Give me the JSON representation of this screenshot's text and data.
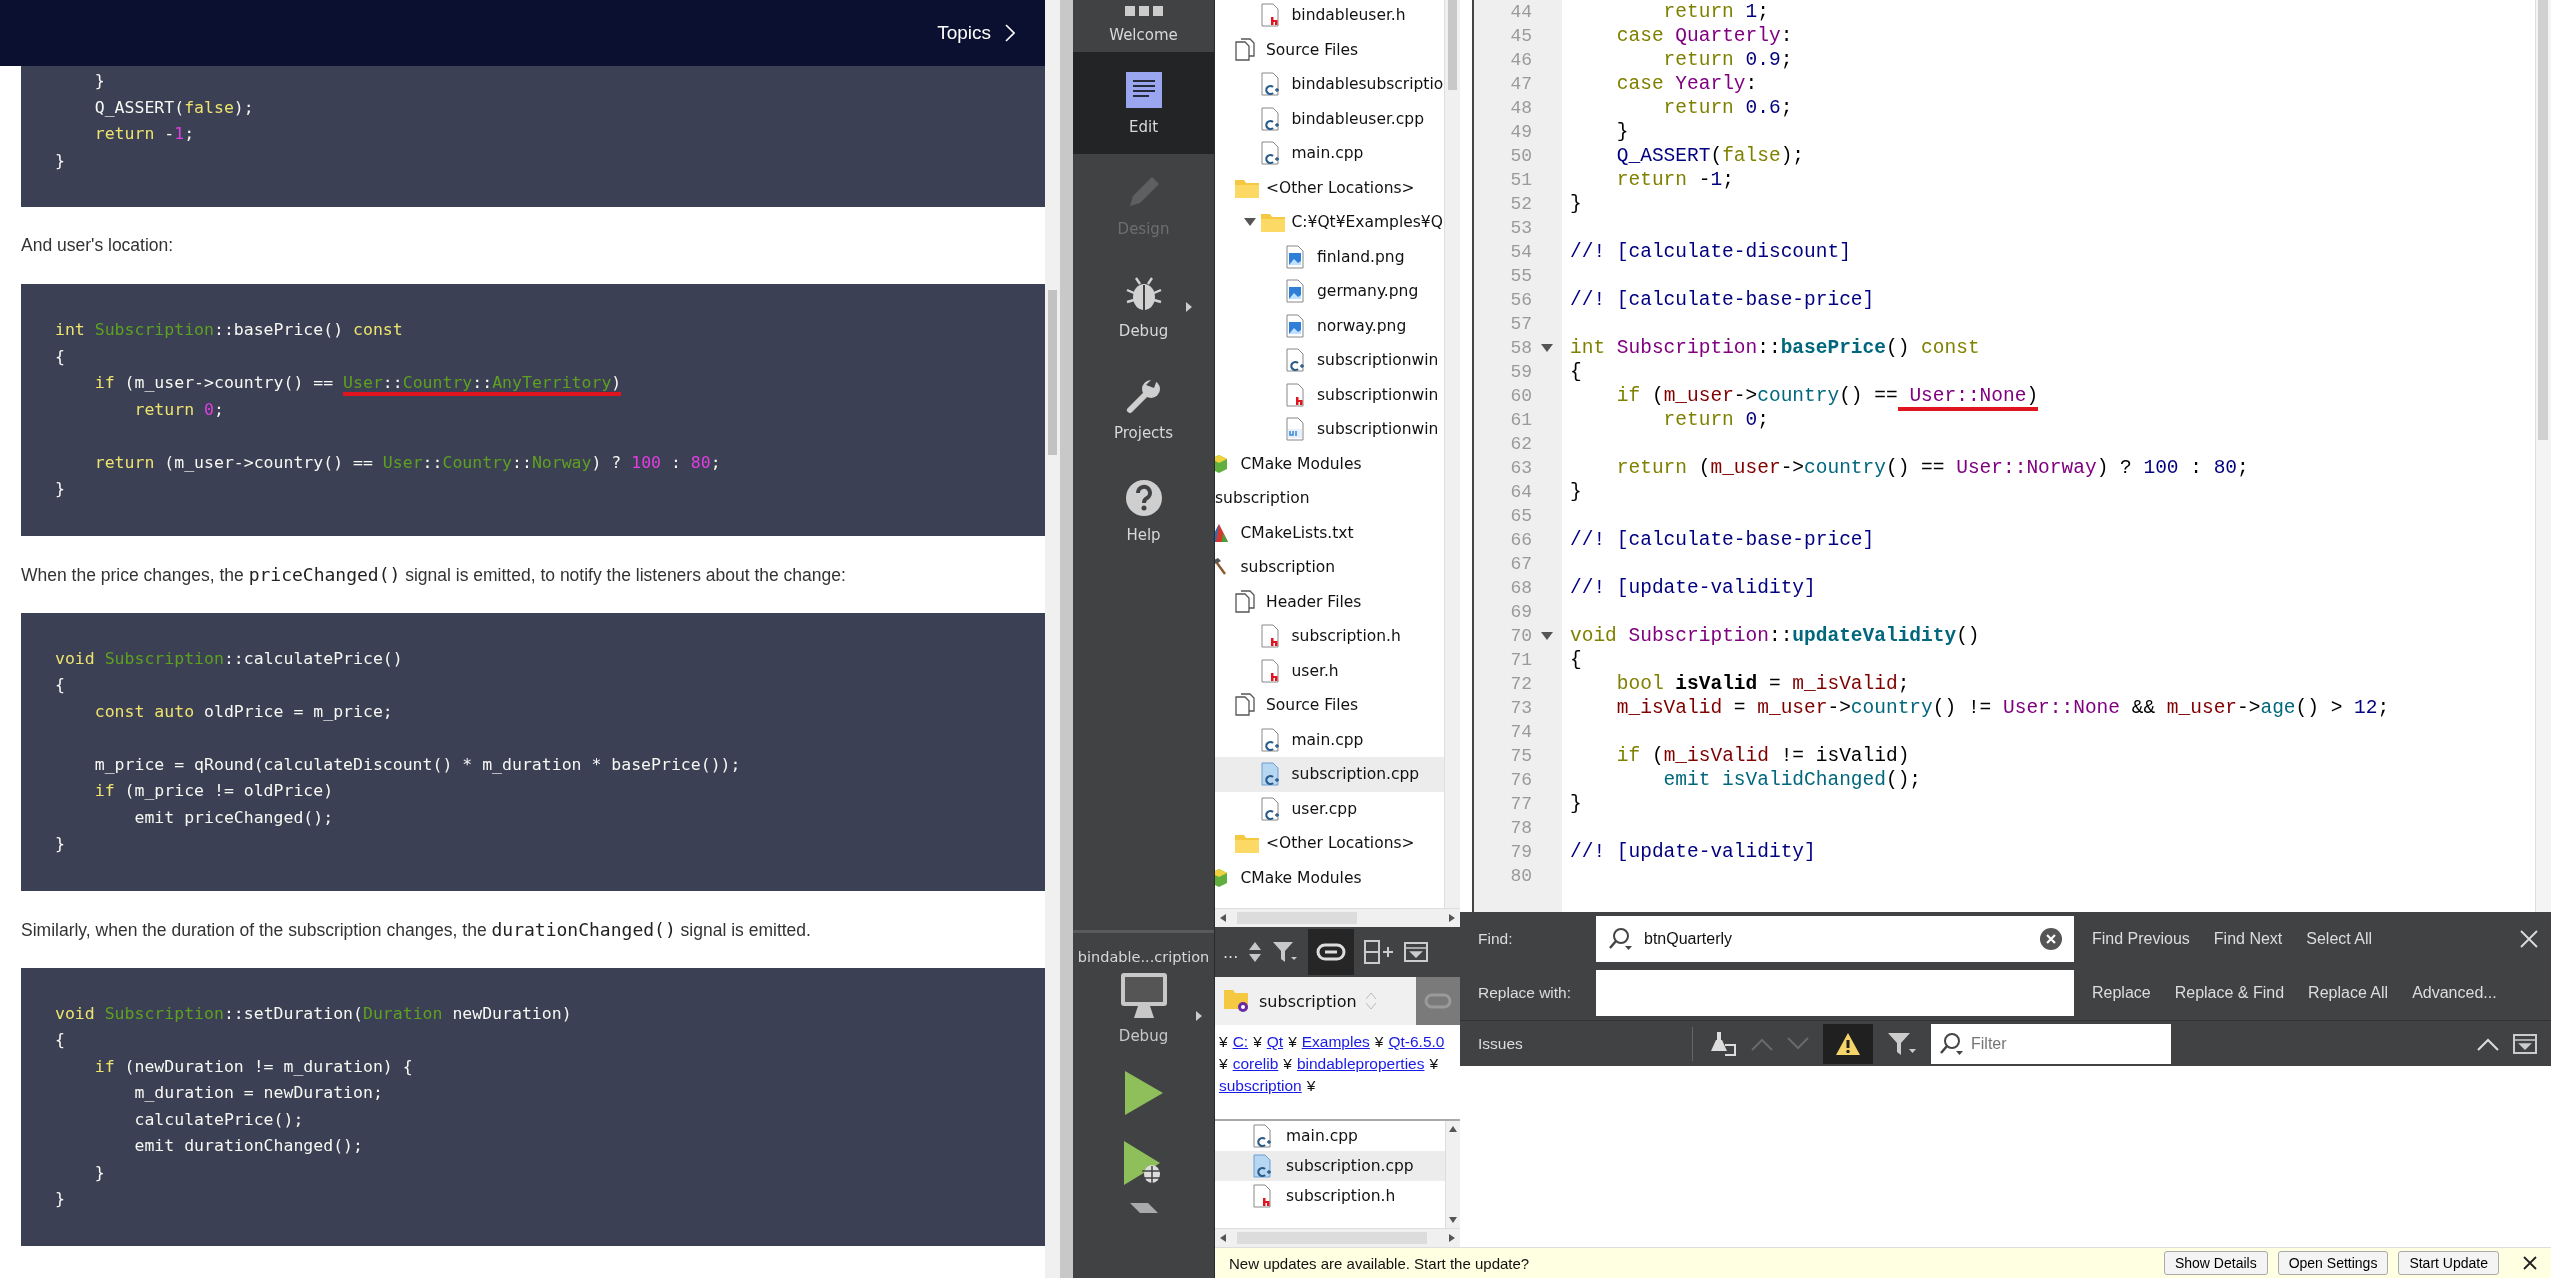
{
  "doc": {
    "header": {
      "topics": "Topics"
    },
    "content": [
      {
        "kind": "code",
        "lines": [
          [
            {
              "text": "    }",
              "kind": "plain"
            }
          ],
          [
            {
              "text": "    Q_ASSERT(",
              "kind": "plain"
            },
            {
              "text": "false",
              "kind": "keyword"
            },
            {
              "text": ");",
              "kind": "plain"
            }
          ],
          [
            {
              "text": "    return",
              "kind": "keyword"
            },
            {
              "text": " -",
              "kind": "plain"
            },
            {
              "text": "1",
              "kind": "number"
            },
            {
              "text": ";",
              "kind": "plain"
            }
          ],
          [
            {
              "text": "}",
              "kind": "plain"
            }
          ]
        ]
      },
      {
        "kind": "paragraph",
        "parts": [
          {
            "text": "And user's location:",
            "kind": "text"
          }
        ]
      },
      {
        "kind": "code",
        "lines": [
          [
            {
              "text": "int",
              "kind": "keyword"
            },
            {
              "text": " Subscription",
              "kind": "type"
            },
            {
              "text": "::basePrice() ",
              "kind": "plain"
            },
            {
              "text": "const",
              "kind": "keyword"
            }
          ],
          [
            {
              "text": "{",
              "kind": "plain"
            }
          ],
          [
            {
              "text": "    if",
              "kind": "keyword"
            },
            {
              "text": " (m_user->country() == ",
              "kind": "plain"
            },
            {
              "text": "User",
              "kind": "type",
              "marked": true
            },
            {
              "text": "::",
              "kind": "plain",
              "marked": true
            },
            {
              "text": "Country",
              "kind": "type",
              "marked": true
            },
            {
              "text": "::",
              "kind": "plain",
              "marked": true
            },
            {
              "text": "AnyTerritory",
              "kind": "type",
              "marked": true
            },
            {
              "text": ")",
              "kind": "plain",
              "marked": true
            }
          ],
          [
            {
              "text": "        return",
              "kind": "keyword"
            },
            {
              "text": " 0",
              "kind": "number"
            },
            {
              "text": ";",
              "kind": "plain"
            }
          ],
          {
            "kind": "blank"
          },
          [
            {
              "text": "    return",
              "kind": "keyword"
            },
            {
              "text": " (m_user->country() == ",
              "kind": "plain"
            },
            {
              "text": "User",
              "kind": "type"
            },
            {
              "text": "::",
              "kind": "plain"
            },
            {
              "text": "Country",
              "kind": "type"
            },
            {
              "text": "::",
              "kind": "plain"
            },
            {
              "text": "Norway",
              "kind": "type"
            },
            {
              "text": ") ? ",
              "kind": "plain"
            },
            {
              "text": "100",
              "kind": "number"
            },
            {
              "text": " : ",
              "kind": "plain"
            },
            {
              "text": "80",
              "kind": "number"
            },
            {
              "text": ";",
              "kind": "plain"
            }
          ],
          [
            {
              "text": "}",
              "kind": "plain"
            }
          ]
        ]
      },
      {
        "kind": "paragraph",
        "parts": [
          {
            "text": "When the price changes, the ",
            "kind": "text"
          },
          {
            "text": "priceChanged()",
            "kind": "code"
          },
          {
            "text": " signal is emitted, to notify the listeners about the change:",
            "kind": "text"
          }
        ]
      },
      {
        "kind": "code",
        "lines": [
          [
            {
              "text": "void",
              "kind": "keyword"
            },
            {
              "text": " Subscription",
              "kind": "type"
            },
            {
              "text": "::calculatePrice()",
              "kind": "plain"
            }
          ],
          [
            {
              "text": "{",
              "kind": "plain"
            }
          ],
          [
            {
              "text": "    const auto",
              "kind": "keyword"
            },
            {
              "text": " oldPrice = m_price;",
              "kind": "plain"
            }
          ],
          {
            "kind": "blank"
          },
          [
            {
              "text": "    m_price = qRound(calculateDiscount() * m_duration * basePrice());",
              "kind": "plain"
            }
          ],
          [
            {
              "text": "    if",
              "kind": "keyword"
            },
            {
              "text": " (m_price != oldPrice)",
              "kind": "plain"
            }
          ],
          [
            {
              "text": "        emit priceChanged();",
              "kind": "plain"
            }
          ],
          [
            {
              "text": "}",
              "kind": "plain"
            }
          ]
        ]
      },
      {
        "kind": "paragraph",
        "parts": [
          {
            "text": "Similarly, when the duration of the subscription changes, the ",
            "kind": "text"
          },
          {
            "text": "durationChanged()",
            "kind": "code"
          },
          {
            "text": " signal is emitted.",
            "kind": "text"
          }
        ]
      },
      {
        "kind": "code",
        "lines": [
          [
            {
              "text": "void",
              "kind": "keyword"
            },
            {
              "text": " Subscription",
              "kind": "type"
            },
            {
              "text": "::setDuration(",
              "kind": "plain"
            },
            {
              "text": "Duration",
              "kind": "type"
            },
            {
              "text": " newDuration)",
              "kind": "plain"
            }
          ],
          [
            {
              "text": "{",
              "kind": "plain"
            }
          ],
          [
            {
              "text": "    if",
              "kind": "keyword"
            },
            {
              "text": " (newDuration != m_duration) {",
              "kind": "plain"
            }
          ],
          [
            {
              "text": "        m_duration = newDuration;",
              "kind": "plain"
            }
          ],
          [
            {
              "text": "        calculatePrice();",
              "kind": "plain"
            }
          ],
          [
            {
              "text": "        emit durationChanged();",
              "kind": "plain"
            }
          ],
          [
            {
              "text": "    }",
              "kind": "plain"
            }
          ],
          [
            {
              "text": "}",
              "kind": "plain"
            }
          ]
        ]
      }
    ]
  },
  "modes": [
    {
      "label": "Welcome",
      "kind": "welcome",
      "selected": false,
      "disabled": false
    },
    {
      "label": "Edit",
      "kind": "edit",
      "selected": true,
      "disabled": false
    },
    {
      "label": "Design",
      "kind": "design",
      "selected": false,
      "disabled": true
    },
    {
      "label": "Debug",
      "kind": "debug",
      "selected": false,
      "disabled": false
    },
    {
      "label": "Projects",
      "kind": "projects",
      "selected": false,
      "disabled": false
    },
    {
      "label": "Help",
      "kind": "help",
      "selected": false,
      "disabled": false
    }
  ],
  "target": {
    "project": "bindable...cription",
    "config": "Debug"
  },
  "run_buttons": [
    {
      "kind": "run"
    },
    {
      "kind": "debug-run"
    },
    {
      "kind": "build"
    }
  ],
  "tree": [
    {
      "children": [
        {
          "children": [
            {
              "children": [
                {
                  "label": "bindableuser.h",
                  "kind": "header",
                  "selected": false
                }
              ]
            },
            {
              "label": "Source Files",
              "kind": "files",
              "selected": false,
              "children": [
                {
                  "label": "bindablesubscriptio",
                  "kind": "cpp",
                  "selected": false
                },
                {
                  "label": "bindableuser.cpp",
                  "kind": "cpp",
                  "selected": false
                },
                {
                  "label": "main.cpp",
                  "kind": "cpp",
                  "selected": false
                }
              ]
            },
            {
              "label": "<Other Locations>",
              "kind": "folder",
              "selected": false,
              "children": [
                {
                  "label": "C:¥Qt¥Examples¥Q",
                  "kind": "folder",
                  "selected": false,
                  "expanded": true,
                  "children": [
                    {
                      "label": "finland.png",
                      "kind": "image",
                      "selected": false
                    },
                    {
                      "label": "germany.png",
                      "kind": "image",
                      "selected": false
                    },
                    {
                      "label": "norway.png",
                      "kind": "image",
                      "selected": false
                    },
                    {
                      "label": "subscriptionwin",
                      "kind": "cpp",
                      "selected": false
                    },
                    {
                      "label": "subscriptionwin",
                      "kind": "header",
                      "selected": false
                    },
                    {
                      "label": "subscriptionwin",
                      "kind": "ui",
                      "selected": false
                    }
                  ]
                }
              ]
            }
          ]
        },
        {
          "label": "CMake Modules",
          "kind": "cmake",
          "selected": false
        }
      ]
    },
    {
      "label": "subscription",
      "selected": false,
      "children": [
        {
          "label": "CMakeLists.txt",
          "kind": "cmakelists",
          "selected": false
        },
        {
          "label": "subscription",
          "kind": "target",
          "selected": false,
          "children": [
            {
              "label": "Header Files",
              "kind": "files",
              "selected": false,
              "children": [
                {
                  "label": "subscription.h",
                  "kind": "header",
                  "selected": false
                },
                {
                  "label": "user.h",
                  "kind": "header",
                  "selected": false
                }
              ]
            },
            {
              "label": "Source Files",
              "kind": "files",
              "selected": false,
              "children": [
                {
                  "label": "main.cpp",
                  "kind": "cpp",
                  "selected": false
                },
                {
                  "label": "subscription.cpp",
                  "kind": "cpp",
                  "selected": true
                },
                {
                  "label": "user.cpp",
                  "kind": "cpp",
                  "selected": false
                }
              ]
            },
            {
              "label": "<Other Locations>",
              "kind": "folder",
              "selected": false
            }
          ]
        },
        {
          "label": "CMake Modules",
          "kind": "cmake",
          "selected": false
        }
      ]
    }
  ],
  "side_toolbar": {
    "elided": "..."
  },
  "project_combo": {
    "value": "subscription"
  },
  "breadcrumbs": [
    "C:",
    "Qt",
    "Examples",
    "Qt-6.5.0",
    "corelib",
    "bindableproperties",
    "subscription"
  ],
  "breadcrumb_separator": "¥",
  "open_documents": [
    {
      "label": "main.cpp",
      "kind": "cpp",
      "selected": false
    },
    {
      "label": "subscription.cpp",
      "kind": "cpp",
      "selected": true
    },
    {
      "label": "subscription.h",
      "kind": "header",
      "selected": false
    }
  ],
  "editor": {
    "lines": [
      {
        "number": "44",
        "fold": false,
        "tokens": [
          {
            "text": "        return",
            "kind": "keyword"
          },
          {
            "text": " 1",
            "kind": "number"
          },
          {
            "text": ";",
            "kind": "plain"
          }
        ]
      },
      {
        "number": "45",
        "fold": false,
        "tokens": [
          {
            "text": "    case",
            "kind": "keyword"
          },
          {
            "text": " Quarterly",
            "kind": "type"
          },
          {
            "text": ":",
            "kind": "plain"
          }
        ]
      },
      {
        "number": "46",
        "fold": false,
        "tokens": [
          {
            "text": "        return",
            "kind": "keyword"
          },
          {
            "text": " 0.9",
            "kind": "number"
          },
          {
            "text": ";",
            "kind": "plain"
          }
        ]
      },
      {
        "number": "47",
        "fold": false,
        "tokens": [
          {
            "text": "    case",
            "kind": "keyword"
          },
          {
            "text": " Yearly",
            "kind": "type"
          },
          {
            "text": ":",
            "kind": "plain"
          }
        ]
      },
      {
        "number": "48",
        "fold": false,
        "tokens": [
          {
            "text": "        return",
            "kind": "keyword"
          },
          {
            "text": " 0.6",
            "kind": "number"
          },
          {
            "text": ";",
            "kind": "plain"
          }
        ]
      },
      {
        "number": "49",
        "fold": false,
        "tokens": [
          {
            "text": "    }",
            "kind": "plain"
          }
        ]
      },
      {
        "number": "50",
        "fold": false,
        "tokens": [
          {
            "text": "    Q_ASSERT",
            "kind": "macro"
          },
          {
            "text": "(",
            "kind": "plain"
          },
          {
            "text": "false",
            "kind": "keyword"
          },
          {
            "text": ");",
            "kind": "plain"
          }
        ]
      },
      {
        "number": "51",
        "fold": false,
        "tokens": [
          {
            "text": "    return",
            "kind": "keyword"
          },
          {
            "text": " -",
            "kind": "plain"
          },
          {
            "text": "1",
            "kind": "number"
          },
          {
            "text": ";",
            "kind": "plain"
          }
        ]
      },
      {
        "number": "52",
        "fold": false,
        "tokens": [
          {
            "text": "}",
            "kind": "plain"
          }
        ]
      },
      {
        "number": "53",
        "fold": false
      },
      {
        "number": "54",
        "fold": false,
        "tokens": [
          {
            "text": "//! [calculate-discount]",
            "kind": "comment"
          }
        ]
      },
      {
        "number": "55",
        "fold": false
      },
      {
        "number": "56",
        "fold": false,
        "tokens": [
          {
            "text": "//! [calculate-base-price]",
            "kind": "comment"
          }
        ]
      },
      {
        "number": "57",
        "fold": false
      },
      {
        "number": "58",
        "fold": true,
        "tokens": [
          {
            "text": "int",
            "kind": "keyword"
          },
          {
            "text": " Subscription",
            "kind": "type"
          },
          {
            "text": "::",
            "kind": "plain"
          },
          {
            "text": "basePrice",
            "kind": "function"
          },
          {
            "text": "() ",
            "kind": "plain"
          },
          {
            "text": "const",
            "kind": "keyword"
          }
        ]
      },
      {
        "number": "59",
        "fold": false,
        "tokens": [
          {
            "text": "{",
            "kind": "plain"
          }
        ]
      },
      {
        "number": "60",
        "fold": false,
        "tokens": [
          {
            "text": "    if",
            "kind": "keyword"
          },
          {
            "text": " (",
            "kind": "plain"
          },
          {
            "text": "m_user",
            "kind": "member"
          },
          {
            "text": "->",
            "kind": "plain"
          },
          {
            "text": "country",
            "kind": "call"
          },
          {
            "text": "() ==",
            "kind": "plain"
          },
          {
            "text": " User::None",
            "kind": "type",
            "marked": true
          },
          {
            "text": ")",
            "kind": "plain",
            "marked": true
          }
        ]
      },
      {
        "number": "61",
        "fold": false,
        "tokens": [
          {
            "text": "        return",
            "kind": "keyword"
          },
          {
            "text": " 0",
            "kind": "number"
          },
          {
            "text": ";",
            "kind": "plain"
          }
        ]
      },
      {
        "number": "62",
        "fold": false
      },
      {
        "number": "63",
        "fold": false,
        "tokens": [
          {
            "text": "    return",
            "kind": "keyword"
          },
          {
            "text": " (",
            "kind": "plain"
          },
          {
            "text": "m_user",
            "kind": "member"
          },
          {
            "text": "->",
            "kind": "plain"
          },
          {
            "text": "country",
            "kind": "call"
          },
          {
            "text": "() == ",
            "kind": "plain"
          },
          {
            "text": "User::Norway",
            "kind": "type"
          },
          {
            "text": ") ? ",
            "kind": "plain"
          },
          {
            "text": "100",
            "kind": "number"
          },
          {
            "text": " : ",
            "kind": "plain"
          },
          {
            "text": "80",
            "kind": "number"
          },
          {
            "text": ";",
            "kind": "plain"
          }
        ]
      },
      {
        "number": "64",
        "fold": false,
        "tokens": [
          {
            "text": "}",
            "kind": "plain"
          }
        ]
      },
      {
        "number": "65",
        "fold": false
      },
      {
        "number": "66",
        "fold": false,
        "tokens": [
          {
            "text": "//! [calculate-base-price]",
            "kind": "comment"
          }
        ]
      },
      {
        "number": "67",
        "fold": false
      },
      {
        "number": "68",
        "fold": false,
        "tokens": [
          {
            "text": "//! [update-validity]",
            "kind": "comment"
          }
        ]
      },
      {
        "number": "69",
        "fold": false
      },
      {
        "number": "70",
        "fold": true,
        "tokens": [
          {
            "text": "void",
            "kind": "keyword"
          },
          {
            "text": " Subscription",
            "kind": "type"
          },
          {
            "text": "::",
            "kind": "plain"
          },
          {
            "text": "updateValidity",
            "kind": "function"
          },
          {
            "text": "()",
            "kind": "plain"
          }
        ]
      },
      {
        "number": "71",
        "fold": false,
        "tokens": [
          {
            "text": "{",
            "kind": "plain"
          }
        ]
      },
      {
        "number": "72",
        "fold": false,
        "tokens": [
          {
            "text": "    bool",
            "kind": "keyword"
          },
          {
            "text": " isValid",
            "kind": "local"
          },
          {
            "text": " = ",
            "kind": "plain"
          },
          {
            "text": "m_isValid",
            "kind": "member"
          },
          {
            "text": ";",
            "kind": "plain"
          }
        ]
      },
      {
        "number": "73",
        "fold": false,
        "tokens": [
          {
            "text": "    m_isValid",
            "kind": "member"
          },
          {
            "text": " = ",
            "kind": "plain"
          },
          {
            "text": "m_user",
            "kind": "member"
          },
          {
            "text": "->",
            "kind": "plain"
          },
          {
            "text": "country",
            "kind": "call"
          },
          {
            "text": "() != ",
            "kind": "plain"
          },
          {
            "text": "User::None",
            "kind": "type"
          },
          {
            "text": " && ",
            "kind": "plain"
          },
          {
            "text": "m_user",
            "kind": "member"
          },
          {
            "text": "->",
            "kind": "plain"
          },
          {
            "text": "age",
            "kind": "call"
          },
          {
            "text": "() > ",
            "kind": "plain"
          },
          {
            "text": "12",
            "kind": "number"
          },
          {
            "text": ";",
            "kind": "plain"
          }
        ]
      },
      {
        "number": "74",
        "fold": false
      },
      {
        "number": "75",
        "fold": false,
        "tokens": [
          {
            "text": "    if",
            "kind": "keyword"
          },
          {
            "text": " (",
            "kind": "plain"
          },
          {
            "text": "m_isValid",
            "kind": "member"
          },
          {
            "text": " != isValid)",
            "kind": "plain"
          }
        ]
      },
      {
        "number": "76",
        "fold": false,
        "tokens": [
          {
            "text": "        emit isValidChanged",
            "kind": "call"
          },
          {
            "text": "();",
            "kind": "plain"
          }
        ]
      },
      {
        "number": "77",
        "fold": false,
        "tokens": [
          {
            "text": "}",
            "kind": "plain"
          }
        ]
      },
      {
        "number": "78",
        "fold": false
      },
      {
        "number": "79",
        "fold": false,
        "tokens": [
          {
            "text": "//! [update-validity]",
            "kind": "comment"
          }
        ]
      },
      {
        "number": "80",
        "fold": false
      }
    ]
  },
  "find_bar": {
    "find_label": "Find:",
    "find_value": "btnQuarterly",
    "replace_label": "Replace with:",
    "row1_buttons": [
      "Find Previous",
      "Find Next",
      "Select All"
    ],
    "row2_buttons": [
      "Replace",
      "Replace & Find",
      "Replace All",
      "Advanced..."
    ]
  },
  "issues": {
    "title": "Issues",
    "warnings_on": true,
    "filter_placeholder": "Filter"
  },
  "notification": {
    "message": "New updates are available. Start the update?",
    "buttons": [
      "Show Details",
      "Open Settings",
      "Start Update"
    ]
  }
}
